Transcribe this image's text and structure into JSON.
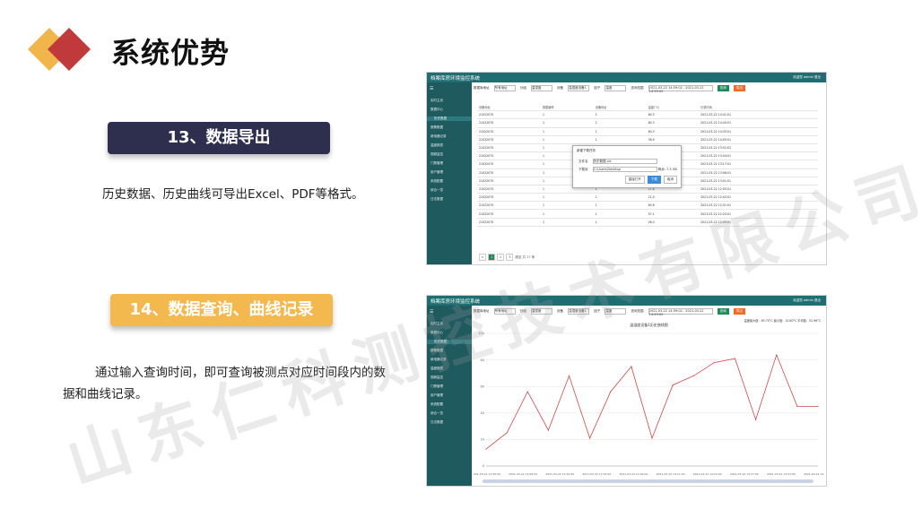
{
  "slide": {
    "title": "系统优势",
    "watermark": "山东仁科测控技术有限公司",
    "section1": {
      "label": "13、数据导出",
      "desc": "历史数据、历史曲线可导出Excel、PDF等格式。"
    },
    "section2": {
      "label": "14、数据查询、曲线记录",
      "desc": "通过输入查询时间，即可查询被测点对应时间段内的数据和曲线记录。"
    }
  },
  "screenshot1": {
    "app_title": "档案库房环境监控系统",
    "topbar_right": "欢迎您 admin  退出",
    "menu_icon": "hamburger-icon",
    "sidebar": [
      "实时主页",
      "数据中心",
      "历史数据",
      "报警数据",
      "继电器记录",
      "温度报表",
      "视频监控",
      "门禁管理",
      "用户管理",
      "系统配置",
      "综合一览",
      "日志数据"
    ],
    "sidebar_active": 2,
    "filter": {
      "f1": "数据库地址",
      "v1": "所有地址",
      "f2": "分组",
      "v2": "温湿度",
      "f3": "设备",
      "v3": "温湿度设备1",
      "f4": "因子",
      "v4": "温度",
      "f5": "查询范围",
      "v5": "2021-03-22 14:59:02 - 2021-03-22 14:59:02",
      "search": "查询",
      "export": "导出"
    },
    "columns": [
      "设备地址",
      "数据编号",
      "设备地址",
      "温度(°C)",
      "记录时间"
    ],
    "rows": [
      [
        "21022070",
        "1",
        "1",
        "80.3",
        "2021-03-22 14:41:01"
      ],
      [
        "21022070",
        "1",
        "1",
        "80.3",
        "2021-03-22 14:40:01"
      ],
      [
        "21022070",
        "1",
        "1",
        "80.3",
        "2021-03-22 14:35:01"
      ],
      [
        "21022070",
        "1",
        "1",
        "36.9",
        "2021-03-22 14:05:01"
      ],
      [
        "21022070",
        "1",
        "1",
        "70.2",
        "2021-03-22 13:52:01"
      ],
      [
        "21022070",
        "1",
        "1",
        "20.1",
        "2021-03-22 13:44:01"
      ],
      [
        "21022070",
        "1",
        "1",
        "37.5",
        "2021-03-22 13:17:01"
      ],
      [
        "21022070",
        "1",
        "1",
        "22.6",
        "2021-03-22 13:08:01"
      ],
      [
        "21022070",
        "1",
        "1",
        "27.8",
        "2021-03-22 13:01:01"
      ],
      [
        "21022070",
        "1",
        "1",
        "17.4",
        "2021-03-22 12:55:01"
      ],
      [
        "21022070",
        "1",
        "1",
        "21.0",
        "2021-03-22 12:43:01"
      ],
      [
        "21022070",
        "1",
        "1",
        "60.6",
        "2021-03-22 12:31:01"
      ],
      [
        "21022070",
        "1",
        "1",
        "57.1",
        "2021-03-22 12:20:01"
      ],
      [
        "21022070",
        "1",
        "1",
        "26.0",
        "2021-03-22 12:05:01"
      ]
    ],
    "dialog": {
      "title": "新建下载任务",
      "name_label": "文件名",
      "name_value": "历史数据.xls",
      "path_label": "下载到",
      "path_value": "C:\\Users\\Desktop",
      "free": "剩余: 7.3 GB",
      "btn_open": "直接打开",
      "btn_download": "下载",
      "btn_cancel": "取消"
    },
    "pager": {
      "prev": "<",
      "pages": [
        "1",
        "2",
        "3"
      ],
      "goto": "跳至",
      "total": "共 17 条"
    }
  },
  "screenshot2": {
    "app_title": "档案库房环境监控系统",
    "topbar_right": "欢迎您 admin  退出",
    "sidebar": [
      "实时主页",
      "数据中心",
      "历史数据",
      "报警数据",
      "继电器记录",
      "温度报表",
      "视频监控",
      "门禁管理",
      "用户管理",
      "系统配置",
      "综合一览",
      "日志数据"
    ],
    "sidebar_active": 2,
    "filter": {
      "f1": "数据库地址",
      "v1": "所有地址",
      "f2": "分组",
      "v2": "温湿度",
      "f3": "设备",
      "v3": "温湿度设备1",
      "f4": "因子",
      "v4": "温度",
      "f5": "查询范围",
      "v5": "2021-03-22 14:59:02 - 2021-03-22 14:59:02",
      "search": "查询",
      "export": "导出"
    },
    "chart_info": "温度最大值：83.75°C  最小值：12.80°C  平均值：52.96°C",
    "line_color": "#c94a4a"
  },
  "chart_data": {
    "type": "line",
    "title": "温湿度设备1历史曲线图",
    "x": [
      "2021-03-22 11:56:00",
      "",
      "2021-03-22 12:08:00",
      "",
      "2021-03-22 12:20:00",
      "",
      "2021-03-22 12:32:00",
      "",
      "2021-03-22 14:04:00",
      "",
      "2021-03-22 14:11:00",
      "",
      "2021-03-22 14:22:00",
      "",
      "2021-03-22 14:37:00",
      "",
      "2021-03-22 14:53:00",
      "",
      "2021-03-22 14:59:00"
    ],
    "values": [
      12.8,
      25,
      56,
      27,
      68,
      21,
      56,
      75,
      21,
      61,
      68,
      78,
      81,
      35,
      83.75,
      45,
      45
    ],
    "ylim": [
      0,
      100
    ],
    "yticks": [
      "0",
      "20",
      "40",
      "60",
      "80",
      "100"
    ],
    "grid": true
  }
}
